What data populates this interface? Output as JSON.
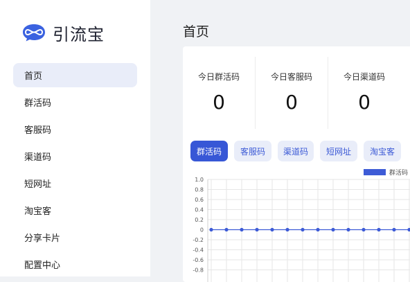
{
  "app": {
    "name": "引流宝",
    "logo_icon": "infinity-chat-logo-icon",
    "accent": "#3757d6"
  },
  "sidebar": {
    "items": [
      {
        "label": "首页",
        "active": true
      },
      {
        "label": "群活码"
      },
      {
        "label": "客服码"
      },
      {
        "label": "渠道码"
      },
      {
        "label": "短网址"
      },
      {
        "label": "淘宝客"
      },
      {
        "label": "分享卡片"
      },
      {
        "label": "配置中心"
      }
    ]
  },
  "main": {
    "title": "首页",
    "stats": [
      {
        "label": "今日群活码",
        "value": "0"
      },
      {
        "label": "今日客服码",
        "value": "0"
      },
      {
        "label": "今日渠道码",
        "value": "0"
      }
    ],
    "tabs": [
      {
        "label": "群活码",
        "active": true
      },
      {
        "label": "客服码"
      },
      {
        "label": "渠道码"
      },
      {
        "label": "短网址"
      },
      {
        "label": "淘宝客"
      }
    ]
  },
  "chart_data": {
    "type": "line",
    "series": [
      {
        "name": "群活码",
        "color": "#3d5bd6",
        "values": [
          0,
          0,
          0,
          0,
          0,
          0,
          0,
          0,
          0,
          0,
          0,
          0,
          0,
          0
        ]
      }
    ],
    "yticks": [
      "1.0",
      "0.8",
      "0.6",
      "0.4",
      "0.2",
      "0",
      "-0.2",
      "-0.4",
      "-0.6",
      "-0.8"
    ],
    "ylim": [
      -0.8,
      1.0
    ],
    "legend_position": "top-right",
    "grid": true
  }
}
